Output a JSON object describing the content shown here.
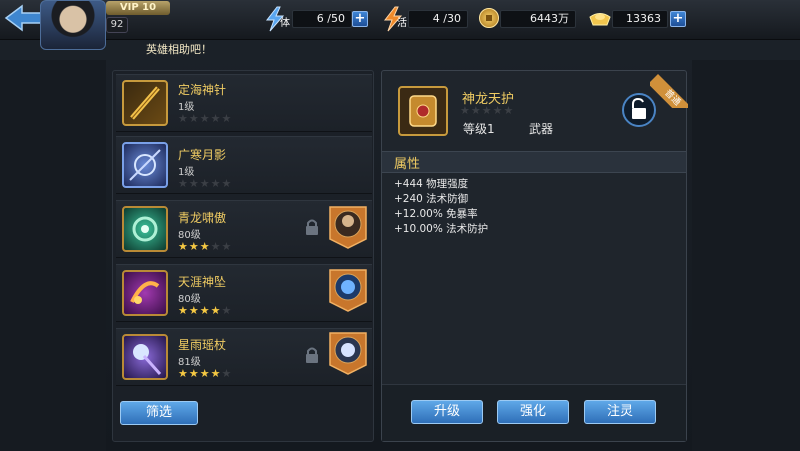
{
  "topbar": {
    "vip": "VIP 10",
    "level": "92",
    "stamina": {
      "label": "体",
      "value": "6 /50"
    },
    "vitality": {
      "label": "活",
      "value": "4 /30"
    },
    "gold": {
      "value": "6443万"
    },
    "ingots": {
      "value": "13363"
    },
    "plus": "+"
  },
  "marquee": "英雄相助吧！",
  "items": [
    {
      "name": "定海神针",
      "level": "1级",
      "stars": 0,
      "locked": false,
      "hero": false
    },
    {
      "name": "广寒月影",
      "level": "1级",
      "stars": 0,
      "locked": false,
      "hero": false
    },
    {
      "name": "青龙啸傲",
      "level": "80级",
      "stars": 3,
      "locked": true,
      "hero": true
    },
    {
      "name": "天涯神坠",
      "level": "80级",
      "stars": 4,
      "locked": false,
      "hero": true
    },
    {
      "name": "星雨瑶杖",
      "level": "81级",
      "stars": 4,
      "locked": true,
      "hero": true
    }
  ],
  "filter_label": "筛选",
  "detail": {
    "name": "神龙天护",
    "level": "等级1",
    "type": "武器",
    "stars": 0,
    "ribbon": "普通",
    "attr_title": "属性",
    "attributes": [
      "+444 物理强度",
      "+240 法术防御",
      "+12.00% 免暴率",
      "+10.00% 法术防护"
    ]
  },
  "actions": [
    "升级",
    "强化",
    "注灵"
  ],
  "colors": {
    "accent_gold": "#f0cc63",
    "button_blue": "#3b83cf",
    "star": "#f5c843"
  }
}
